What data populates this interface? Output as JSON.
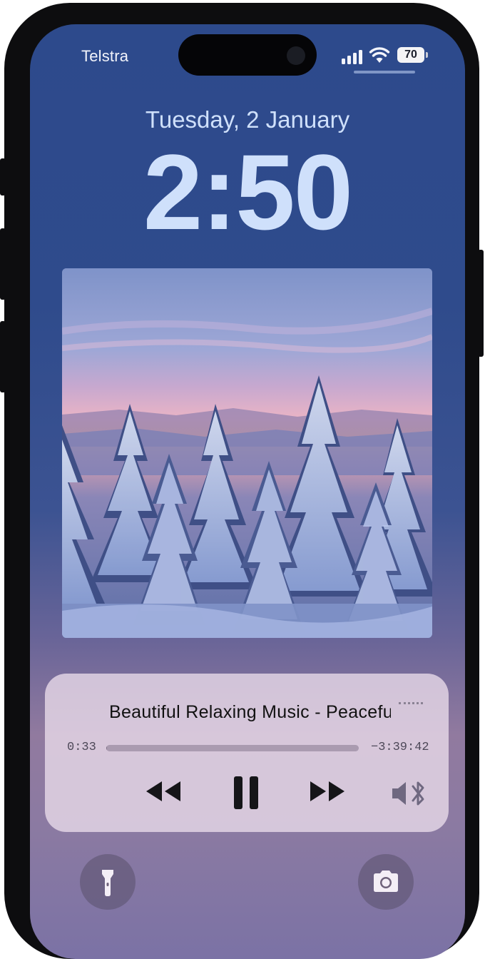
{
  "status_bar": {
    "carrier": "Telstra",
    "battery": "70",
    "signal_icon": "cellular-signal-icon",
    "wifi_icon": "wifi-icon"
  },
  "lock_screen": {
    "date": "Tuesday, 2 January",
    "time": "2:50"
  },
  "now_playing": {
    "title": "Beautiful Relaxing Music - Peaceful Soothing Instrumental Music",
    "elapsed": "0:33",
    "remaining": "−3:39:42",
    "progress": 0.003,
    "controls": [
      "rewind-icon",
      "pause-icon",
      "fast-forward-icon",
      "bluetooth-speaker-icon"
    ]
  },
  "quick_actions": {
    "left": "flashlight-icon",
    "right": "camera-icon"
  },
  "colors": {
    "text_light": "#cfe0fb",
    "player_bg": "#ebdceb",
    "screen_top": "#2d4a8c",
    "screen_bottom": "#7b72a5"
  }
}
